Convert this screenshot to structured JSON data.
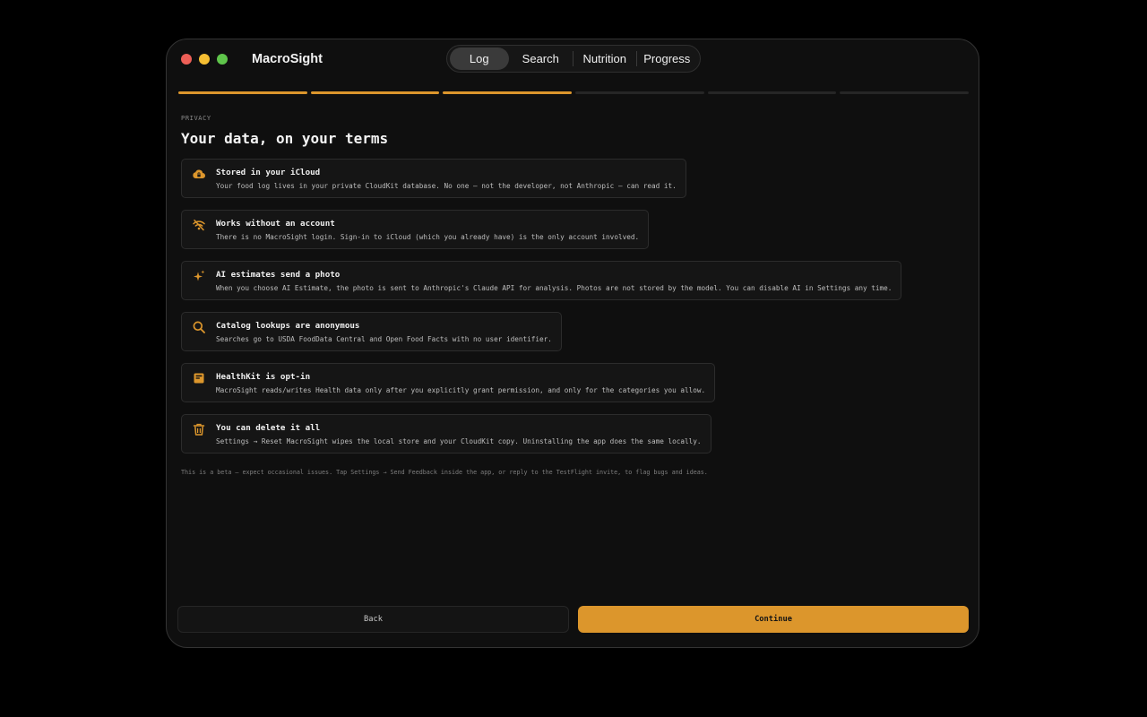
{
  "app": {
    "title": "MacroSight"
  },
  "tabs": [
    {
      "label": "Log",
      "active": true
    },
    {
      "label": "Search",
      "active": false
    },
    {
      "label": "Nutrition",
      "active": false
    },
    {
      "label": "Progress",
      "active": false
    }
  ],
  "progress": {
    "total_steps": 6,
    "completed_steps": 3,
    "active_color": "#dc962c",
    "inactive_color": "#262626"
  },
  "page": {
    "eyebrow": "PRIVACY",
    "heading": "Your data, on your terms",
    "accent_color": "#dc962c"
  },
  "cards": [
    {
      "icon": "cloud-lock-icon",
      "title": "Stored in your iCloud",
      "description": "Your food log lives in your private CloudKit database. No one — not the developer, not Anthropic — can read it."
    },
    {
      "icon": "wifi-off-icon",
      "title": "Works without an account",
      "description": "There is no MacroSight login. Sign-in to iCloud (which you already have) is the only account involved."
    },
    {
      "icon": "sparkles-icon",
      "title": "AI estimates send a photo",
      "description": "When you choose AI Estimate, the photo is sent to Anthropic's Claude API for analysis. Photos are not stored by the model. You can disable AI in Settings any time."
    },
    {
      "icon": "search-icon",
      "title": "Catalog lookups are anonymous",
      "description": "Searches go to USDA FoodData Central and Open Food Facts with no user identifier."
    },
    {
      "icon": "health-record-icon",
      "title": "HealthKit is opt-in",
      "description": "MacroSight reads/writes Health data only after you explicitly grant permission, and only for the categories you allow."
    },
    {
      "icon": "trash-icon",
      "title": "You can delete it all",
      "description": "Settings → Reset MacroSight wipes the local store and your CloudKit copy. Uninstalling the app does the same locally."
    }
  ],
  "footnote": "This is a beta — expect occasional issues. Tap Settings → Send Feedback inside the app, or reply to the TestFlight invite, to flag bugs and ideas.",
  "buttons": {
    "back_label": "Back",
    "continue_label": "Continue"
  }
}
